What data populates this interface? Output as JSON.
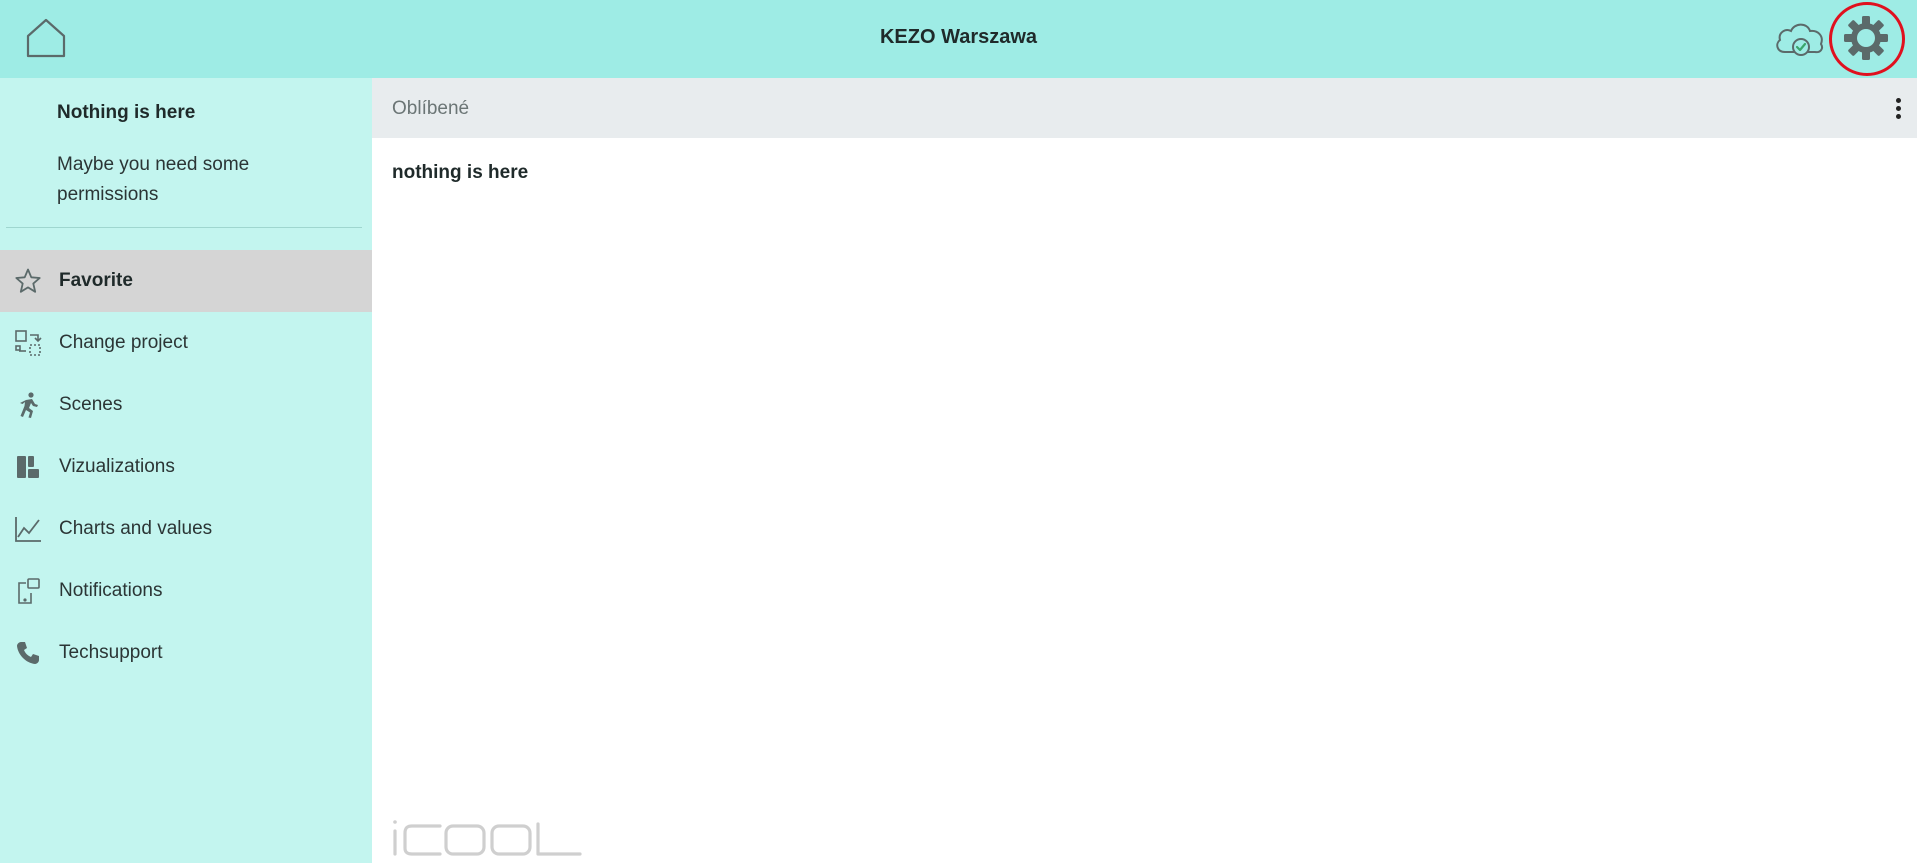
{
  "app": {
    "title": "KEZO Warszawa"
  },
  "topbar": {
    "home_icon": "home-icon",
    "cloud_icon": "cloud-check-icon",
    "settings_icon": "gear-icon",
    "highlight_color": "#e0101e"
  },
  "sidebar": {
    "empty_title": "Nothing is here",
    "empty_subtitle": "Maybe you need some permissions",
    "items": [
      {
        "label": "Favorite",
        "icon": "star-icon",
        "active": true
      },
      {
        "label": "Change project",
        "icon": "swap-project-icon",
        "active": false
      },
      {
        "label": "Scenes",
        "icon": "running-person-icon",
        "active": false
      },
      {
        "label": "Vizualizations",
        "icon": "layout-blocks-icon",
        "active": false
      },
      {
        "label": "Charts and values",
        "icon": "line-chart-icon",
        "active": false
      },
      {
        "label": "Notifications",
        "icon": "phone-notification-icon",
        "active": false
      },
      {
        "label": "Techsupport",
        "icon": "phone-icon",
        "active": false
      }
    ]
  },
  "main": {
    "header_title": "Oblíbené",
    "message": "nothing is here"
  },
  "footer": {
    "logo_text": "iCOOL"
  },
  "colors": {
    "topbar": "#9eece5",
    "sidebar": "#c3f5ef",
    "active_item": "#d5d5d5",
    "content_header": "#e8ecee"
  }
}
